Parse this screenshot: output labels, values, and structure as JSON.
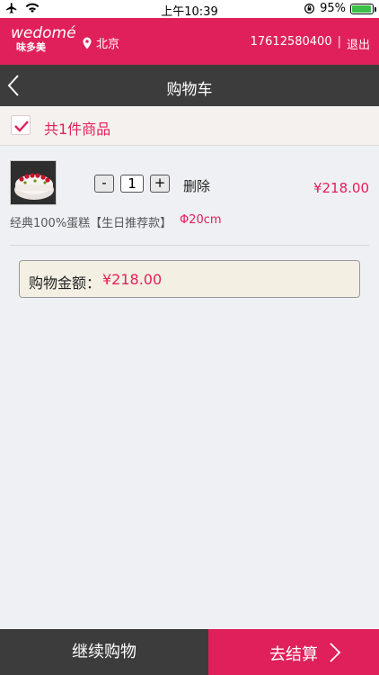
{
  "status": {
    "time": "上午10:39",
    "battery": "95%",
    "battery_level": 0.95
  },
  "brand": {
    "logo_en": "wedomé",
    "logo_cn": "味多美",
    "location": "北京",
    "phone": "17612580400",
    "separator": "|",
    "logout": "退出",
    "color": "#e0205a"
  },
  "nav": {
    "title": "购物车"
  },
  "select_all": {
    "checked": true,
    "count_label": "共1件商品"
  },
  "cart": {
    "items": [
      {
        "name": "经典100%蛋糕【生日推荐款】",
        "size": "Φ20cm",
        "qty_minus": "-",
        "quantity": "1",
        "qty_plus": "+",
        "delete_label": "删除",
        "price": "¥218.00"
      }
    ],
    "total_label": "购物金额：",
    "total_amount": "¥218.00"
  },
  "bottom": {
    "continue_label": "继续购物",
    "checkout_label": "去结算"
  }
}
